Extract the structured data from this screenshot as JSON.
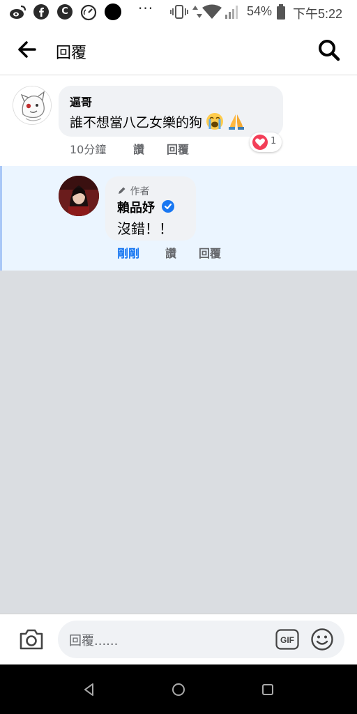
{
  "status_bar": {
    "app_icon_1": "weibo-icon",
    "app_icon_2": "facebook-icon",
    "app_icon_3_letter": "C",
    "dots": "···",
    "battery_percent": "54%",
    "time": "下午5:22"
  },
  "header": {
    "title": "回覆"
  },
  "comment": {
    "author": "逼哥",
    "text": "誰不想當八乙女樂的狗",
    "emojis": [
      "loudly-crying-face",
      "folded-hands"
    ],
    "time": "10分鐘",
    "like_label": "讚",
    "reply_label": "回覆",
    "reaction_count": "1",
    "reaction_type": "love"
  },
  "reply": {
    "badge": "作者",
    "author": "賴品妤",
    "verified": true,
    "text": "沒錯！！",
    "time": "剛剛",
    "like_label": "讚",
    "reply_label": "回覆"
  },
  "composer": {
    "placeholder": "回覆......",
    "gif_label": "GIF"
  },
  "colors": {
    "accent_blue": "#1877f2",
    "love_red": "#f33e58",
    "bubble_gray": "#f0f2f5",
    "highlight_bg": "#ebf5ff",
    "empty_bg": "#dadde1"
  }
}
